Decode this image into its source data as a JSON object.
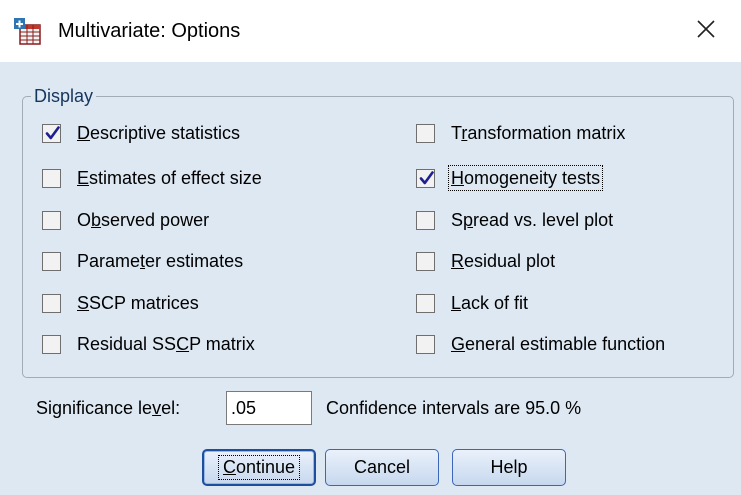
{
  "window": {
    "title": "Multivariate: Options",
    "app_icon": "spss-table-icon",
    "close_icon": "close-icon"
  },
  "display": {
    "legend": "Display",
    "left": [
      {
        "pre": "",
        "key": "D",
        "post": "escriptive statistics",
        "checked": true
      },
      {
        "pre": "",
        "key": "E",
        "post": "stimates of effect size",
        "checked": false
      },
      {
        "pre": "O",
        "key": "b",
        "post": "served power",
        "checked": false
      },
      {
        "pre": "Parame",
        "key": "t",
        "post": "er estimates",
        "checked": false
      },
      {
        "pre": "",
        "key": "S",
        "post": "SCP matrices",
        "checked": false
      },
      {
        "pre": "Residual SS",
        "key": "C",
        "post": "P matrix",
        "checked": false
      }
    ],
    "right": [
      {
        "pre": "T",
        "key": "r",
        "post": "ansformation matrix",
        "checked": false
      },
      {
        "pre": "",
        "key": "H",
        "post": "omogeneity tests",
        "checked": true,
        "focused": true
      },
      {
        "pre": "S",
        "key": "p",
        "post": "read vs. level plot",
        "checked": false
      },
      {
        "pre": "",
        "key": "R",
        "post": "esidual plot",
        "checked": false
      },
      {
        "pre": "",
        "key": "L",
        "post": "ack of fit",
        "checked": false
      },
      {
        "pre": "",
        "key": "G",
        "post": "eneral estimable function",
        "checked": false
      }
    ]
  },
  "significance": {
    "label_pre": "Significance le",
    "label_key": "v",
    "label_post": "el:",
    "value": ".05",
    "confidence_text": "Confidence intervals are 95.0 %"
  },
  "buttons": {
    "continue_key": "C",
    "continue_rest": "ontinue",
    "cancel": "Cancel",
    "help": "Help"
  }
}
